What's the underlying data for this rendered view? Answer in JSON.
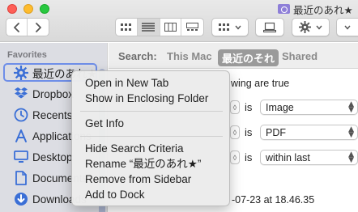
{
  "window": {
    "title": "最近のあれ★"
  },
  "toolbar": {
    "back_icon": "chevron-left-icon",
    "forward_icon": "chevron-right-icon",
    "views": [
      "icon-view-icon",
      "list-view-icon",
      "column-view-icon",
      "gallery-view-icon"
    ],
    "selected_view": "list-view-icon",
    "group_icon": "group-by-icon",
    "share_icon": "share-icon",
    "action_icon": "gear-icon"
  },
  "sidebar": {
    "header": "Favorites",
    "items": [
      {
        "label": "最近のあれ★",
        "icon": "gear-icon"
      },
      {
        "label": "Dropbox",
        "icon": "dropbox-icon"
      },
      {
        "label": "Recents",
        "icon": "clock-icon"
      },
      {
        "label": "Applications",
        "icon": "applications-icon"
      },
      {
        "label": "Desktop",
        "icon": "desktop-icon"
      },
      {
        "label": "Documents",
        "icon": "document-icon"
      },
      {
        "label": "Downloads",
        "icon": "download-icon"
      }
    ]
  },
  "search": {
    "label": "Search:",
    "scopes": [
      "This Mac",
      "最近のそれ",
      "Shared"
    ],
    "selected_scope": "最近のそれ"
  },
  "criteria": {
    "header_fragment": "wing are true",
    "rows": [
      {
        "op": "is",
        "value": "Image"
      },
      {
        "op": "is",
        "value": "PDF"
      },
      {
        "op": "is",
        "value": "within last"
      }
    ],
    "date_fragment": "-07-23 at 18.46.35"
  },
  "context_menu": {
    "groups": [
      [
        "Open in New Tab",
        "Show in Enclosing Folder"
      ],
      [
        "Get Info"
      ],
      [
        "Hide Search Criteria",
        "Rename “最近のあれ★”",
        "Remove from Sidebar",
        "Add to Dock"
      ]
    ]
  }
}
